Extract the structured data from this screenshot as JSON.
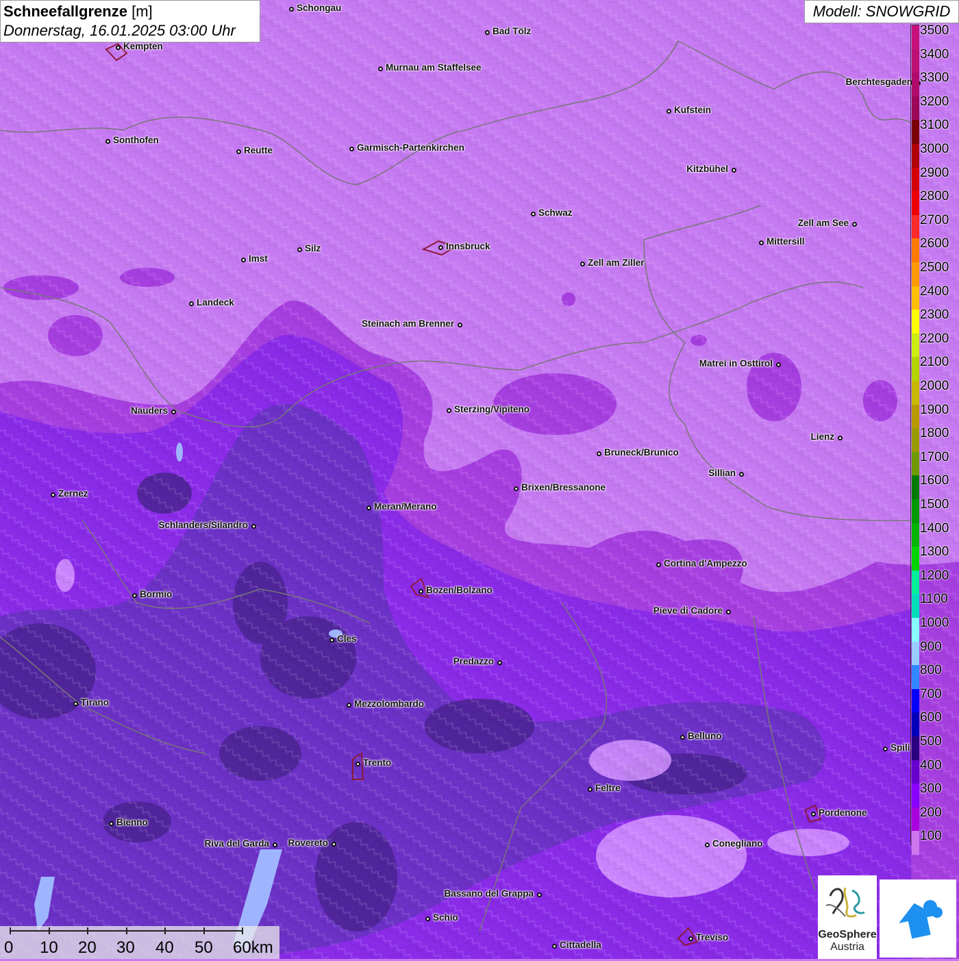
{
  "title": {
    "main_bold": "Schneefallgrenze",
    "main_unit": "[m]",
    "date": "Donnerstag, 16.01.2025 03:00 Uhr"
  },
  "model_label": "Modell: SNOWGRID",
  "legend": {
    "labels": [
      "3500",
      "3400",
      "3300",
      "3200",
      "3100",
      "3000",
      "2900",
      "2800",
      "2700",
      "2600",
      "2500",
      "2400",
      "2300",
      "2200",
      "2100",
      "2000",
      "1900",
      "1800",
      "1700",
      "1600",
      "1500",
      "1400",
      "1300",
      "1200",
      "1100",
      "1000",
      "900",
      "800",
      "700",
      "600",
      "500",
      "400",
      "300",
      "200",
      "100"
    ],
    "colors": [
      "#c8117a",
      "#be0f72",
      "#b00a6a",
      "#9c0758",
      "#7a0000",
      "#b00000",
      "#d40000",
      "#ee0000",
      "#ff2a2a",
      "#ff7a00",
      "#ff9a00",
      "#ffbf00",
      "#ffff00",
      "#ccee11",
      "#b4d400",
      "#c8b800",
      "#b89a00",
      "#9a9a00",
      "#6e9a00",
      "#007a00",
      "#009a00",
      "#00b400",
      "#00d400",
      "#00ee9a",
      "#00ddbb",
      "#88ffff",
      "#99ccff",
      "#3388ff",
      "#0000ff",
      "#0000bb",
      "#2a0080",
      "#6600cc",
      "#8800ff",
      "#aa00dd",
      "#cc77ee"
    ]
  },
  "cities": [
    {
      "name": "Schongau"
    },
    {
      "name": "Kempten"
    },
    {
      "name": "Bad Tölz"
    },
    {
      "name": "Murnau am Staffelsee"
    },
    {
      "name": "Berchtesgaden"
    },
    {
      "name": "Kufstein"
    },
    {
      "name": "Sonthofen"
    },
    {
      "name": "Reutte"
    },
    {
      "name": "Garmisch-Partenkirchen"
    },
    {
      "name": "Kitzbühel"
    },
    {
      "name": "Schwaz"
    },
    {
      "name": "Zell am See"
    },
    {
      "name": "Imst"
    },
    {
      "name": "Silz"
    },
    {
      "name": "Innsbruck"
    },
    {
      "name": "Mittersill"
    },
    {
      "name": "Zell am Ziller"
    },
    {
      "name": "Landeck"
    },
    {
      "name": "Steinach am Brenner"
    },
    {
      "name": "Matrei in Osttirol"
    },
    {
      "name": "Nauders"
    },
    {
      "name": "Sterzing/Vipiteno"
    },
    {
      "name": "Lienz"
    },
    {
      "name": "Bruneck/Brunico"
    },
    {
      "name": "Sillian"
    },
    {
      "name": "Zernez"
    },
    {
      "name": "Brixen/Bressanone"
    },
    {
      "name": "Meran/Merano"
    },
    {
      "name": "Schlanders/Silandro"
    },
    {
      "name": "Cortina d'Ampezzo"
    },
    {
      "name": "Bormio"
    },
    {
      "name": "Bozen/Bolzano"
    },
    {
      "name": "Pieve di Cadore"
    },
    {
      "name": "Cles"
    },
    {
      "name": "Predazzo"
    },
    {
      "name": "Tirano"
    },
    {
      "name": "Mezzolombardo"
    },
    {
      "name": "Belluno"
    },
    {
      "name": "Spili"
    },
    {
      "name": "Trento"
    },
    {
      "name": "Feltre"
    },
    {
      "name": "Pordenone"
    },
    {
      "name": "Bienno"
    },
    {
      "name": "Riva del Garda"
    },
    {
      "name": "Rovereto"
    },
    {
      "name": "Conegliano"
    },
    {
      "name": "Bassano del Grappa"
    },
    {
      "name": "Schio"
    },
    {
      "name": "Treviso"
    },
    {
      "name": "Cittadella"
    }
  ],
  "scale": {
    "labels": [
      "0",
      "10",
      "20",
      "30",
      "40",
      "50",
      "60km"
    ]
  },
  "logo": {
    "line1": "GeoSphere",
    "line2": "Austria"
  }
}
